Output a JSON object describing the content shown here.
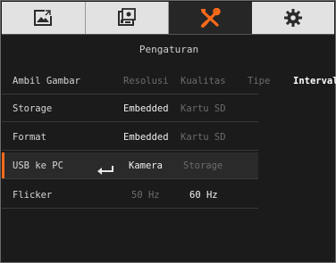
{
  "tabs": [
    {
      "icon": "image-gallery-icon",
      "active": false
    },
    {
      "icon": "camera-capture-icon",
      "active": false
    },
    {
      "icon": "tools-icon",
      "active": true,
      "accent": "#ff6a1a"
    },
    {
      "icon": "gear-icon",
      "active": false
    }
  ],
  "title": "Pengaturan",
  "rows": [
    {
      "label": "Ambil Gambar",
      "options": [
        "Resolusi",
        "Kualitas",
        "Tipe",
        "Interval"
      ],
      "selected_option": "Interval"
    },
    {
      "label": "Storage",
      "options": [
        "Embedded",
        "Kartu SD"
      ],
      "selected_option": "Embedded"
    },
    {
      "label": "Format",
      "options": [
        "Embedded",
        "Kartu SD"
      ],
      "selected_option": "Embedded"
    },
    {
      "label": "USB ke PC",
      "options": [
        "Kamera",
        "Storage"
      ],
      "selected_option": "Kamera",
      "enter_icon": "enter-icon",
      "highlighted": true
    },
    {
      "label": "Flicker",
      "options": [
        "50 Hz",
        "60 Hz"
      ],
      "selected_option": "60 Hz"
    }
  ],
  "colors": {
    "accent": "#ff6a1a",
    "background": "#1b1b1b",
    "tab_bg": "#e2e2e2"
  }
}
